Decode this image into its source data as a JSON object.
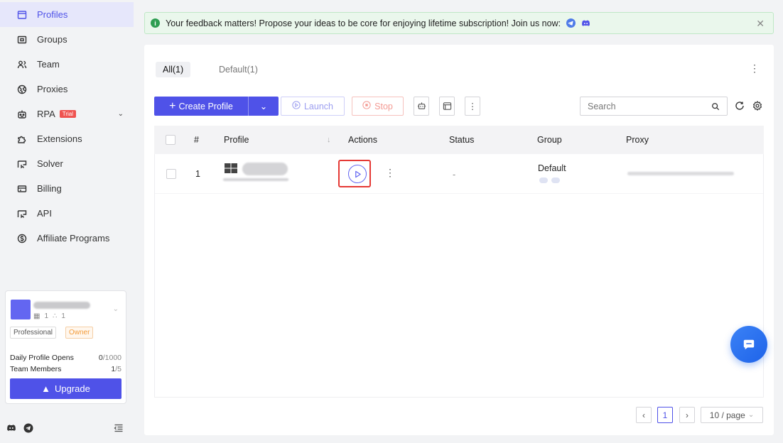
{
  "sidebar": {
    "items": [
      {
        "label": "Profiles",
        "icon": "profiles-icon",
        "active": true
      },
      {
        "label": "Groups",
        "icon": "groups-icon"
      },
      {
        "label": "Team",
        "icon": "team-icon"
      },
      {
        "label": "Proxies",
        "icon": "proxies-icon"
      },
      {
        "label": "RPA",
        "icon": "rpa-icon",
        "badge": "Trial"
      },
      {
        "label": "Extensions",
        "icon": "extensions-icon"
      },
      {
        "label": "Solver",
        "icon": "solver-icon"
      },
      {
        "label": "Billing",
        "icon": "billing-icon"
      },
      {
        "label": "API",
        "icon": "api-icon"
      },
      {
        "label": "Affiliate Programs",
        "icon": "affiliate-icon"
      }
    ],
    "account": {
      "stat_profiles": "1",
      "stat_members": "1",
      "plan_tag": "Professional",
      "role_tag": "Owner",
      "daily_label": "Daily Profile Opens",
      "daily_value": "0",
      "daily_limit": "/1000",
      "members_label": "Team Members",
      "members_value": "1",
      "members_limit": "/5",
      "upgrade_label": "Upgrade"
    }
  },
  "banner": {
    "text": "Your feedback matters! Propose your ideas to be core for enjoying lifetime subscription! Join us now:"
  },
  "tabs": [
    {
      "label": "All(1)",
      "active": true
    },
    {
      "label": "Default(1)",
      "active": false
    }
  ],
  "toolbar": {
    "create_label": "Create Profile",
    "launch_label": "Launch",
    "stop_label": "Stop"
  },
  "search": {
    "placeholder": "Search"
  },
  "table": {
    "columns": [
      "#",
      "Profile",
      "Actions",
      "Status",
      "Group",
      "Proxy"
    ],
    "rows": [
      {
        "index": "1",
        "status": "-",
        "group": "Default"
      }
    ]
  },
  "pagination": {
    "current_page": "1",
    "page_size": "10 / page"
  },
  "colors": {
    "accent": "#4f52e8",
    "highlight": "#e53935",
    "banner_bg": "#eaf7ec"
  }
}
